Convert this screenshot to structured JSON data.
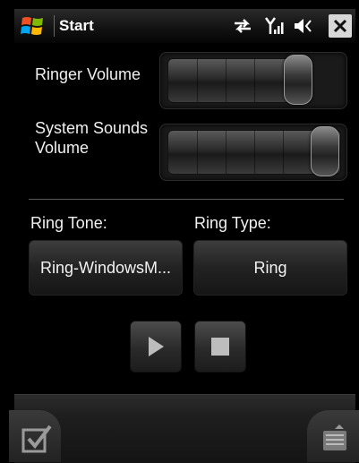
{
  "title_bar": {
    "title": "Start",
    "icons": [
      "windows-logo-icon",
      "connectivity-arrows-icon",
      "signal-strength-icon",
      "speaker-muted-icon",
      "close-icon"
    ]
  },
  "ringer_volume": {
    "label": "Ringer Volume",
    "level": 0.9
  },
  "system_sounds_volume": {
    "label": "System Sounds Volume",
    "level": 1.0
  },
  "ring_tone": {
    "label": "Ring Tone:",
    "value": "Ring-WindowsM..."
  },
  "ring_type": {
    "label": "Ring Type:",
    "value": "Ring"
  },
  "playback": {
    "icons": [
      "play-icon",
      "stop-icon"
    ]
  },
  "bottom_bar": {
    "icons": [
      "checkmark-icon",
      "menu-icon"
    ]
  }
}
